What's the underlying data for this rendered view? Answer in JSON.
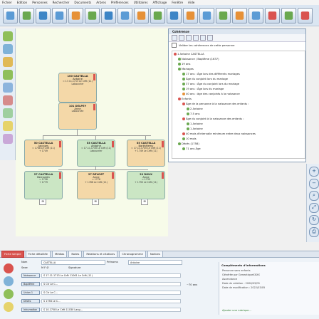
{
  "menu": [
    "Fichier",
    "Edition",
    "Personnes",
    "Rechercher",
    "Documents",
    "Arbres",
    "Préférences",
    "Utilitaires",
    "Affichage",
    "Fenêtre",
    "Aide"
  ],
  "toolbar": {
    "icons": [
      "save-icon",
      "home-icon",
      "search-icon",
      "refresh-icon",
      "pedigree-icon",
      "tree-icon",
      "print-icon",
      "tree-chart-icon",
      "settings-icon",
      "list-icon",
      "zero-icon",
      "tools-icon",
      "question-icon",
      "filter-icon",
      "persons-icon",
      "people-icon",
      "flags-icon",
      "tree-view-icon",
      "close-icon"
    ],
    "zero_label": "0"
  },
  "tree": {
    "persons": [
      {
        "name": "100 CASTELLA",
        "first": "Antoine",
        "date": "≈ 17.11.1713 Le Crêt (11)",
        "death": "Labouvrier"
      },
      {
        "name": "101 DELPEY",
        "first": "Anne",
        "date": "",
        "death": "Labourcée"
      },
      {
        "name": "50 CASTELLA",
        "first": "Jacques",
        "date": "≈ 1748 Le Crêt (11)",
        "death": "+ 1749"
      },
      {
        "name": "53 CASTELLA",
        "first": "Antoine",
        "date": "≈ 17.11.1745 Le Crêt (11)",
        "death": "Labouvrier"
      },
      {
        "name": "55 CASTELLA",
        "first": "Barthélemy",
        "date": "≈ 17.11.1745 Le Crêt (11)",
        "death": "+ 1749 Le Crêt (11)"
      },
      {
        "name": "27 CASTELLA",
        "first": "Bernardin",
        "date": "≈ 1728",
        "death": "+ 1779"
      },
      {
        "name": "27 REVOST",
        "first": "Anne",
        "date": "≈ 1776",
        "death": "+ 1786 Le Crêt (11)"
      },
      {
        "name": "29 ROUX",
        "first": "Anne",
        "date": "≈ 1730",
        "death": "+ 1790 Le Crêt (11)"
      }
    ]
  },
  "coherence": {
    "title": "Cohérence",
    "check_label": "Valider les cohérences de cette personne",
    "rows": [
      "1 Antoine CASTELLA",
      "Naissance / Baptême (1637)",
      "19 ans",
      "Mariages",
      "17 ans : Âge lors des différents mariages",
      "Âge du conjoint lors du mariage",
      "37 ans : Âge du conjoint lors du mariage",
      "19 ans : Âge lors du mariage",
      "40 ans : âge des conjoints à la naissance",
      "Enfants",
      "Âge de la personne à la naissance des enfants :",
      "2 Antoine",
      "7.5 ans",
      "Âge du conjoint à la naissance des enfants :",
      "1 Antoine",
      "1 Antoine",
      "40 mois d'intervalle minimum entre deux naissances",
      "10 mois",
      "Décès (1758)",
      "71 ans Âge"
    ]
  },
  "tabs": [
    "Fiche simple",
    "Fiche détaillée",
    "Médias",
    "Notes",
    "Relations et citations",
    "Chronogramme",
    "Notices"
  ],
  "detail": {
    "nom_label": "Nom",
    "nom": "CASTELLA",
    "sexe_label": "Sexe",
    "sexe_opts": "M   F   Ø",
    "prenom_label": "Prénoms",
    "prenom": "Antoine",
    "signature_label": "Signature",
    "rows": [
      {
        "label": "Naissance",
        "value": "S  17.11.1713  Le Crêt  11061 Le Crêt  (11)"
      },
      {
        "label": "Baptême",
        "value": "S  Ctr  Le C..."
      },
      {
        "label": "Union 1",
        "value": "S  Ctr  Le C..."
      },
      {
        "label": "Décès",
        "value": "S  1758  Le C..."
      },
      {
        "label": "Inhumation",
        "value": "S  10.1758  Le Crêt  11030  Lang..."
      }
    ],
    "info_title": "Compléments d'informations",
    "info_rows": [
      "Personne sans enfants",
      "Générée par GeneatiqueXXXX",
      "Ascendance",
      "Date de création : 2006/03/05",
      "Date de modification : 2022/03/05"
    ],
    "age_label": "~70 ans",
    "status_label": "Ajouter une rubrique..."
  },
  "colors": {
    "accent": "#d9534f",
    "tree_bg": "#f7fbe9",
    "male": "#f4d8a8",
    "female": "#cbe6c4"
  }
}
